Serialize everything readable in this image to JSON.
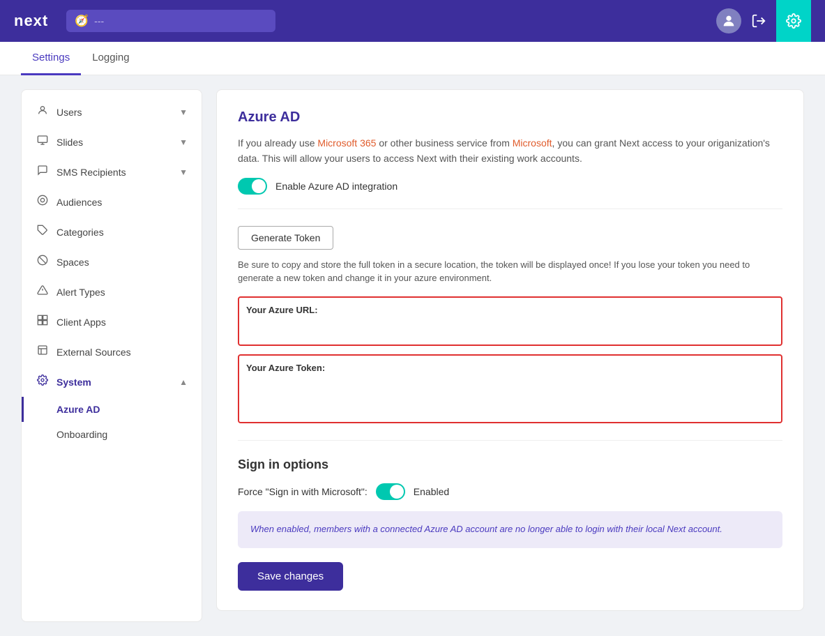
{
  "header": {
    "logo": "next",
    "search_placeholder": "---",
    "search_icon": "🔍"
  },
  "top_nav": {
    "items": [
      {
        "label": "Settings",
        "active": true
      },
      {
        "label": "Logging",
        "active": false
      }
    ]
  },
  "sidebar": {
    "items": [
      {
        "id": "users",
        "label": "Users",
        "icon": "👤",
        "has_chevron": true,
        "expanded": false
      },
      {
        "id": "slides",
        "label": "Slides",
        "icon": "🖥",
        "has_chevron": true,
        "expanded": false
      },
      {
        "id": "sms-recipients",
        "label": "SMS Recipients",
        "icon": "💬",
        "has_chevron": true,
        "expanded": false
      },
      {
        "id": "audiences",
        "label": "Audiences",
        "icon": "⊙",
        "has_chevron": false,
        "expanded": false
      },
      {
        "id": "categories",
        "label": "Categories",
        "icon": "🏷",
        "has_chevron": false,
        "expanded": false
      },
      {
        "id": "spaces",
        "label": "Spaces",
        "icon": "⊘",
        "has_chevron": false,
        "expanded": false
      },
      {
        "id": "alert-types",
        "label": "Alert Types",
        "icon": "△",
        "has_chevron": false,
        "expanded": false
      },
      {
        "id": "client-apps",
        "label": "Client Apps",
        "icon": "⊡",
        "has_chevron": false,
        "expanded": false
      },
      {
        "id": "external-sources",
        "label": "External Sources",
        "icon": "⊟",
        "has_chevron": false,
        "expanded": false
      },
      {
        "id": "system",
        "label": "System",
        "icon": "⚙",
        "has_chevron": true,
        "expanded": true,
        "active_parent": true
      }
    ],
    "sub_items": [
      {
        "id": "azure-ad",
        "label": "Azure AD",
        "active": true
      },
      {
        "id": "onboarding",
        "label": "Onboarding",
        "active": false
      }
    ]
  },
  "main": {
    "azure_ad": {
      "title": "Azure AD",
      "description_part1": "If you already use ",
      "description_ms365": "Microsoft 365",
      "description_part2": " or other business service from ",
      "description_ms": "Microsoft",
      "description_part3": ", you can grant Next access to your origanization's data. This will allow your users to access Next with their existing work accounts.",
      "toggle_label": "Enable Azure AD integration",
      "toggle_enabled": true
    },
    "token_section": {
      "generate_btn_label": "Generate Token",
      "note": "Be sure to copy and store the full token in a secure location, the token will be displayed once! If you lose your token you need to generate a new token and change it in your azure environment.",
      "azure_url_label": "Your Azure URL:",
      "azure_url_value": "",
      "azure_token_label": "Your Azure Token:",
      "azure_token_value": ""
    },
    "sign_in_options": {
      "title": "Sign in options",
      "force_label": "Force \"Sign in with Microsoft\":",
      "enabled_text": "Enabled",
      "toggle_enabled": true,
      "info_text": "When enabled, members with a connected Azure AD account are no longer able to login with their local Next account.",
      "save_btn_label": "Save changes"
    }
  }
}
